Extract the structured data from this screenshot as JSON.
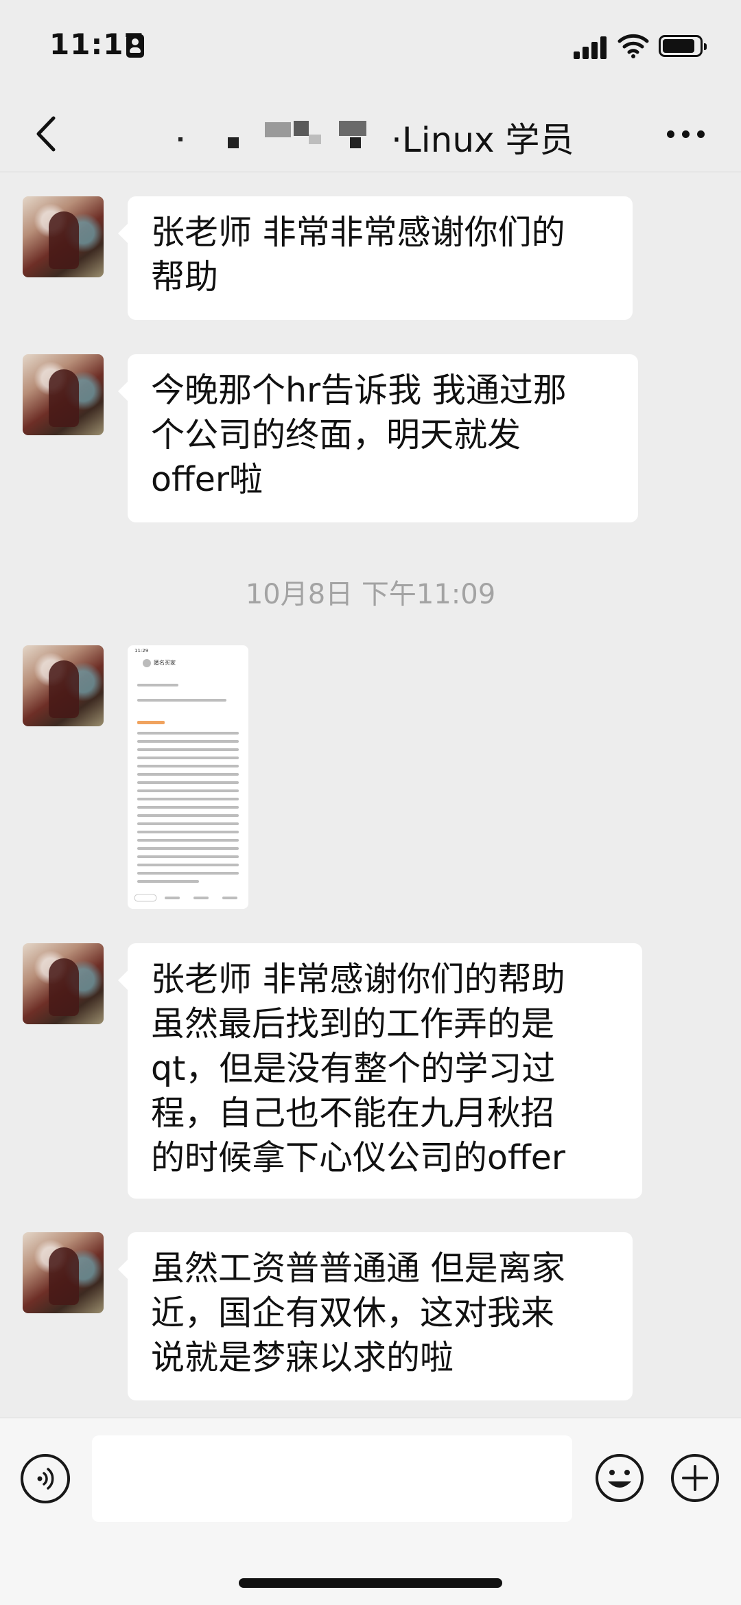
{
  "status_bar": {
    "time": "11:17"
  },
  "header": {
    "title": "·Linux 学员"
  },
  "messages": [
    {
      "lines": [
        "张老师  非常非常感谢你们的",
        "帮助"
      ]
    },
    {
      "lines": [
        "今晚那个hr告诉我  我通过那",
        "个公司的终面，明天就发",
        "offer啦"
      ]
    },
    {
      "lines": [
        "张老师 非常感谢你们的帮助",
        "虽然最后找到的工作弄的是",
        "qt，但是没有整个的学习过",
        "程，自己也不能在九月秋招",
        "的时候拿下心仪公司的offer"
      ]
    },
    {
      "lines": [
        "虽然工资普普通通  但是离家",
        "近，国企有双休，这对我来",
        "说就是梦寐以求的啦"
      ]
    }
  ],
  "timestamp": "10月8日 下午11:09",
  "image_message": {
    "app_time": "11:29",
    "shop_name": "匿名买家"
  },
  "input": {
    "placeholder": ""
  },
  "colors": {
    "background": "#ededed",
    "bubble": "#ffffff",
    "timestamp": "#a3a3a3"
  },
  "icons": [
    "back-arrow-icon",
    "more-icon",
    "voice-icon",
    "emoji-icon",
    "plus-icon",
    "signal-icon",
    "wifi-icon",
    "battery-icon"
  ]
}
